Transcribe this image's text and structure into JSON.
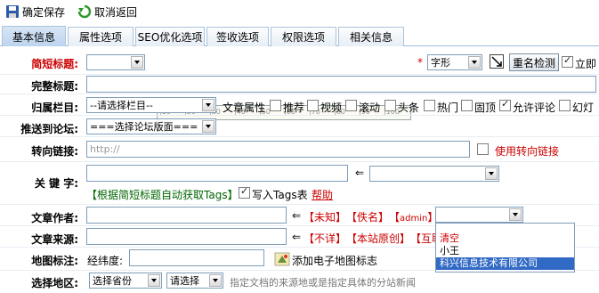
{
  "toolbar": {
    "save": "确定保存",
    "cancel": "取消返回"
  },
  "tabs": [
    "基本信息",
    "属性选项",
    "SEO优化选项",
    "签收选项",
    "权限选项",
    "相关信息"
  ],
  "short_title": {
    "label": "简短标题:",
    "star": "*",
    "font_select": "字形",
    "recheck": "重名检测",
    "immediate": "立即"
  },
  "ruler": [
    "|10",
    "|20",
    "|30",
    "|40",
    "|50",
    "|60",
    "|70",
    "|80",
    "|90",
    "|100"
  ],
  "full_title": {
    "label": "完整标题:"
  },
  "category": {
    "label": "归属栏目:",
    "select": "--请选择栏目--",
    "attr_label": "文章属性",
    "attrs": [
      {
        "label": "推荐",
        "checked": false
      },
      {
        "label": "视频",
        "checked": false
      },
      {
        "label": "滚动",
        "checked": false
      },
      {
        "label": "头条",
        "checked": false
      },
      {
        "label": "热门",
        "checked": false
      },
      {
        "label": "固顶",
        "checked": false
      },
      {
        "label": "允许评论",
        "checked": true
      },
      {
        "label": "幻灯",
        "checked": false
      }
    ]
  },
  "forum": {
    "label": "推送到论坛:",
    "select": "===选择论坛版面==="
  },
  "redirect": {
    "label": "转向链接:",
    "placeholder": "http://",
    "use_label": "使用转向链接"
  },
  "keywords": {
    "label": "关 键 字:",
    "arrow": "⇐",
    "auto": "【根据简短标题自动获取Tags】",
    "write": "写入Tags表",
    "help": "帮助"
  },
  "author": {
    "label": "文章作者:",
    "arrow": "⇐",
    "opt1": "【未知】",
    "opt2": "【佚名】",
    "opt3_pre": "【",
    "opt3": "admin",
    "opt3_post": "】"
  },
  "source": {
    "label": "文章来源:",
    "arrow": "⇐",
    "opt1": "【不详】",
    "opt2": "【本站原创】",
    "opt3": "【互联"
  },
  "dropdown": {
    "items": [
      "清空",
      "小王",
      "科兴信息技术有限公司"
    ]
  },
  "map": {
    "label": "地图标注:",
    "lonlat": "经纬度:",
    "add": "添加电子地图标志"
  },
  "region": {
    "label": "选择地区:",
    "province": "选择省份",
    "city": "请选择",
    "hint": "指定文档的来源地或是指定具体的分站新闻"
  }
}
